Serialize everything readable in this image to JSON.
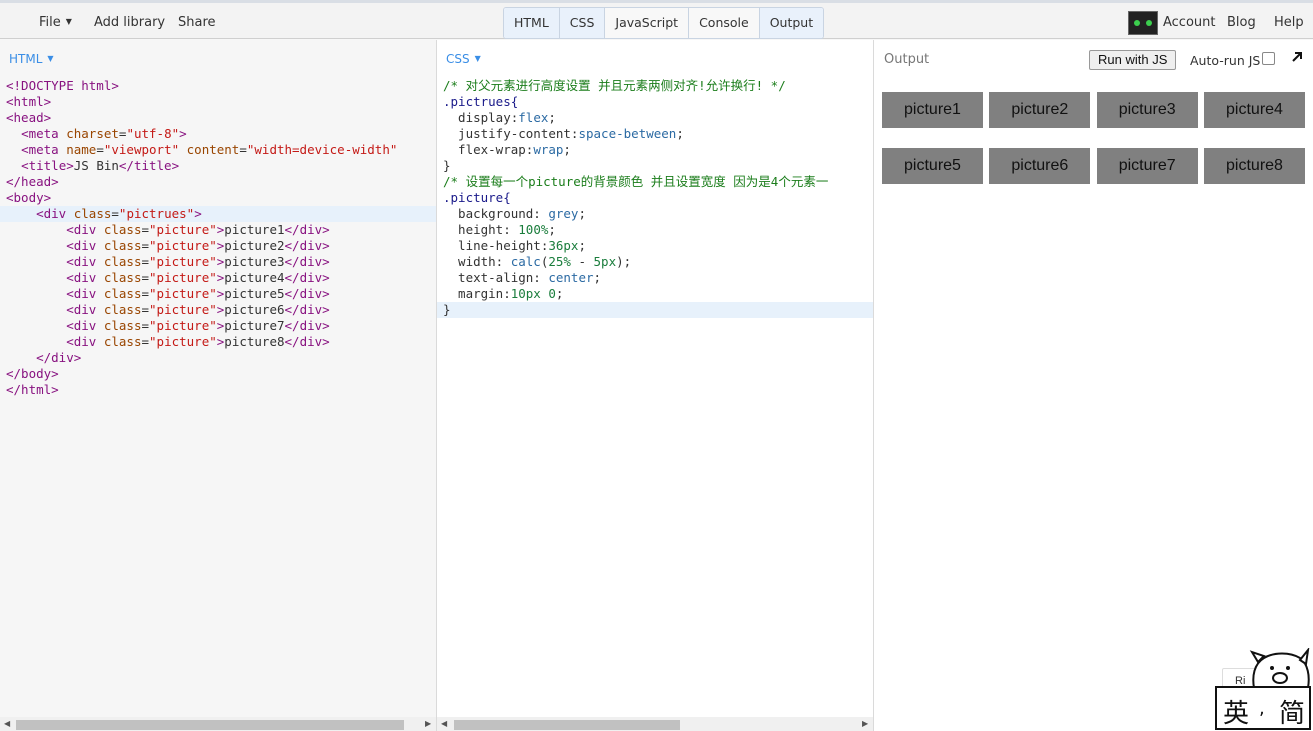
{
  "topbar": {
    "menu": [
      "File",
      "Add library",
      "Share"
    ],
    "toggles": [
      "HTML",
      "CSS",
      "JavaScript",
      "Console",
      "Output"
    ],
    "account": "Account",
    "blog": "Blog",
    "help": "Help"
  },
  "html_panel": {
    "label": "HTML",
    "lines": [
      [
        [
          "tag",
          "<!DOCTYPE html>"
        ]
      ],
      [
        [
          "tag",
          "<html>"
        ]
      ],
      [
        [
          "tag",
          "<head>"
        ]
      ],
      [
        [
          "txt",
          "  "
        ],
        [
          "tag",
          "<meta "
        ],
        [
          "attr",
          "charset"
        ],
        [
          "txt",
          "="
        ],
        [
          "str",
          "\"utf-8\""
        ],
        [
          "tag",
          ">"
        ]
      ],
      [
        [
          "txt",
          "  "
        ],
        [
          "tag",
          "<meta "
        ],
        [
          "attr",
          "name"
        ],
        [
          "txt",
          "="
        ],
        [
          "str",
          "\"viewport\""
        ],
        [
          "txt",
          " "
        ],
        [
          "attr",
          "content"
        ],
        [
          "txt",
          "="
        ],
        [
          "str",
          "\"width=device-width\""
        ]
      ],
      [
        [
          "txt",
          "  "
        ],
        [
          "tag",
          "<title>"
        ],
        [
          "txt",
          "JS Bin"
        ],
        [
          "tag",
          "</title>"
        ]
      ],
      [
        [
          "tag",
          "</head>"
        ]
      ],
      [
        [
          "tag",
          "<body>"
        ]
      ],
      [
        [
          "txt",
          "    "
        ],
        [
          "tag",
          "<div "
        ],
        [
          "attr",
          "class"
        ],
        [
          "txt",
          "="
        ],
        [
          "str",
          "\"pictrues\""
        ],
        [
          "tag",
          ">"
        ]
      ],
      [
        [
          "txt",
          "        "
        ],
        [
          "tag",
          "<div "
        ],
        [
          "attr",
          "class"
        ],
        [
          "txt",
          "="
        ],
        [
          "str",
          "\"picture\""
        ],
        [
          "tag",
          ">"
        ],
        [
          "txt",
          "picture1"
        ],
        [
          "tag",
          "</div>"
        ]
      ],
      [
        [
          "txt",
          "        "
        ],
        [
          "tag",
          "<div "
        ],
        [
          "attr",
          "class"
        ],
        [
          "txt",
          "="
        ],
        [
          "str",
          "\"picture\""
        ],
        [
          "tag",
          ">"
        ],
        [
          "txt",
          "picture2"
        ],
        [
          "tag",
          "</div>"
        ]
      ],
      [
        [
          "txt",
          "        "
        ],
        [
          "tag",
          "<div "
        ],
        [
          "attr",
          "class"
        ],
        [
          "txt",
          "="
        ],
        [
          "str",
          "\"picture\""
        ],
        [
          "tag",
          ">"
        ],
        [
          "txt",
          "picture3"
        ],
        [
          "tag",
          "</div>"
        ]
      ],
      [
        [
          "txt",
          "        "
        ],
        [
          "tag",
          "<div "
        ],
        [
          "attr",
          "class"
        ],
        [
          "txt",
          "="
        ],
        [
          "str",
          "\"picture\""
        ],
        [
          "tag",
          ">"
        ],
        [
          "txt",
          "picture4"
        ],
        [
          "tag",
          "</div>"
        ]
      ],
      [
        [
          "txt",
          "        "
        ],
        [
          "tag",
          "<div "
        ],
        [
          "attr",
          "class"
        ],
        [
          "txt",
          "="
        ],
        [
          "str",
          "\"picture\""
        ],
        [
          "tag",
          ">"
        ],
        [
          "txt",
          "picture5"
        ],
        [
          "tag",
          "</div>"
        ]
      ],
      [
        [
          "txt",
          "        "
        ],
        [
          "tag",
          "<div "
        ],
        [
          "attr",
          "class"
        ],
        [
          "txt",
          "="
        ],
        [
          "str",
          "\"picture\""
        ],
        [
          "tag",
          ">"
        ],
        [
          "txt",
          "picture6"
        ],
        [
          "tag",
          "</div>"
        ]
      ],
      [
        [
          "txt",
          "        "
        ],
        [
          "tag",
          "<div "
        ],
        [
          "attr",
          "class"
        ],
        [
          "txt",
          "="
        ],
        [
          "str",
          "\"picture\""
        ],
        [
          "tag",
          ">"
        ],
        [
          "txt",
          "picture7"
        ],
        [
          "tag",
          "</div>"
        ]
      ],
      [
        [
          "txt",
          "        "
        ],
        [
          "tag",
          "<div "
        ],
        [
          "attr",
          "class"
        ],
        [
          "txt",
          "="
        ],
        [
          "str",
          "\"picture\""
        ],
        [
          "tag",
          ">"
        ],
        [
          "txt",
          "picture8"
        ],
        [
          "tag",
          "</div>"
        ]
      ],
      [
        [
          "txt",
          "    "
        ],
        [
          "tag",
          "</div>"
        ]
      ],
      [
        [
          "tag",
          "</body>"
        ]
      ],
      [
        [
          "tag",
          "</html>"
        ]
      ]
    ]
  },
  "css_panel": {
    "label": "CSS",
    "lines": [
      [
        [
          "comment",
          "/* 对父元素进行高度设置 并且元素两侧对齐!允许换行! */"
        ]
      ],
      [
        [
          "sel",
          ".pictrues{"
        ]
      ],
      [
        [
          "prop",
          "  display:"
        ],
        [
          "val",
          "flex"
        ],
        [
          "txt",
          ";"
        ]
      ],
      [
        [
          "prop",
          "  justify-content:"
        ],
        [
          "val",
          "space-between"
        ],
        [
          "txt",
          ";"
        ]
      ],
      [
        [
          "prop",
          "  flex-wrap:"
        ],
        [
          "val",
          "wrap"
        ],
        [
          "txt",
          ";"
        ]
      ],
      [
        [
          "txt",
          "}"
        ]
      ],
      [
        [
          "comment",
          "/* 设置每一个picture的背景颜色 并且设置宽度 因为是4个元素一"
        ]
      ],
      [
        [
          "sel",
          ".picture{"
        ]
      ],
      [
        [
          "prop",
          "  background: "
        ],
        [
          "val",
          "grey"
        ],
        [
          "txt",
          ";"
        ]
      ],
      [
        [
          "prop",
          "  height: "
        ],
        [
          "num",
          "100%"
        ],
        [
          "txt",
          ";"
        ]
      ],
      [
        [
          "prop",
          "  line-height:"
        ],
        [
          "num",
          "36px"
        ],
        [
          "txt",
          ";"
        ]
      ],
      [
        [
          "prop",
          "  width: "
        ],
        [
          "val",
          "calc"
        ],
        [
          "txt",
          "("
        ],
        [
          "num",
          "25%"
        ],
        [
          "txt",
          " - "
        ],
        [
          "num",
          "5px"
        ],
        [
          "txt",
          ");"
        ]
      ],
      [
        [
          "prop",
          "  text-align: "
        ],
        [
          "val",
          "center"
        ],
        [
          "txt",
          ";"
        ]
      ],
      [
        [
          "prop",
          "  margin:"
        ],
        [
          "num",
          "10px 0"
        ],
        [
          "txt",
          ";"
        ]
      ],
      [
        [
          "txt",
          "}"
        ]
      ]
    ]
  },
  "output": {
    "title": "Output",
    "run_label": "Run with JS",
    "autorun_label": "Auto-run JS",
    "pictures": [
      "picture1",
      "picture2",
      "picture3",
      "picture4",
      "picture5",
      "picture6",
      "picture7",
      "picture8"
    ],
    "stray_text": "Ri"
  },
  "ime": {
    "left_char": "英",
    "sep": ",",
    "right_char": "简"
  }
}
